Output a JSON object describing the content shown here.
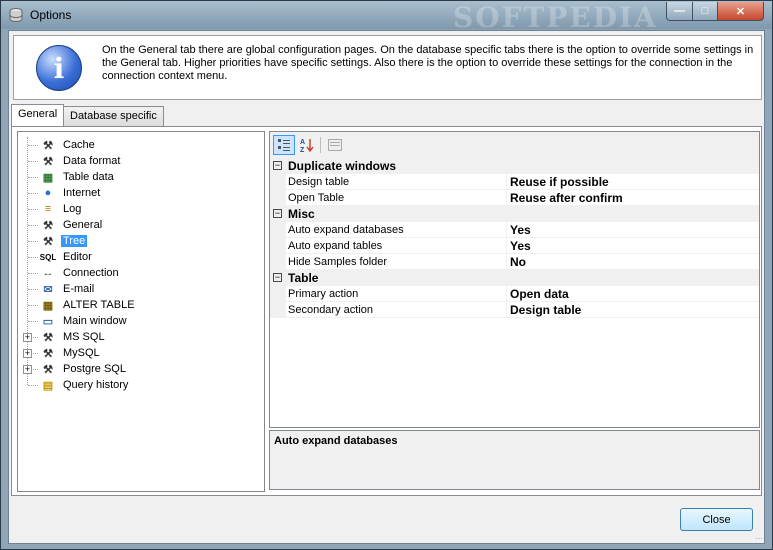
{
  "window": {
    "title": "Options",
    "watermark": "SOFTPEDIA"
  },
  "info": {
    "text": "On the General tab there are global configuration pages. On the database specific tabs there is the option to override some settings in the General tab. Higher priorities have specific settings. Also there is the option to override these settings for the connection in the connection context menu.",
    "icon": "info-icon"
  },
  "tabs": [
    {
      "label": "General",
      "active": true
    },
    {
      "label": "Database specific",
      "active": false
    }
  ],
  "tree": {
    "items": [
      {
        "label": "Cache",
        "icon": "tools-icon"
      },
      {
        "label": "Data format",
        "icon": "tools-icon"
      },
      {
        "label": "Table data",
        "icon": "table-icon"
      },
      {
        "label": "Internet",
        "icon": "globe-icon"
      },
      {
        "label": "Log",
        "icon": "log-icon"
      },
      {
        "label": "General",
        "icon": "tools-icon"
      },
      {
        "label": "Tree",
        "icon": "tools-icon",
        "selected": true
      },
      {
        "label": "Editor",
        "icon": "sql-icon"
      },
      {
        "label": "Connection",
        "icon": "connection-icon"
      },
      {
        "label": "E-mail",
        "icon": "mail-icon"
      },
      {
        "label": "ALTER TABLE",
        "icon": "alter-table-icon"
      },
      {
        "label": "Main window",
        "icon": "window-icon"
      },
      {
        "label": "MS SQL",
        "icon": "tools-icon",
        "expandable": true
      },
      {
        "label": "MySQL",
        "icon": "tools-icon",
        "expandable": true
      },
      {
        "label": "Postgre SQL",
        "icon": "tools-icon",
        "expandable": true
      },
      {
        "label": "Query history",
        "icon": "history-icon"
      }
    ]
  },
  "propgrid": {
    "categories": [
      {
        "label": "Duplicate windows",
        "props": [
          {
            "name": "Design table",
            "value": "Reuse if possible"
          },
          {
            "name": "Open Table",
            "value": "Reuse after confirm"
          }
        ]
      },
      {
        "label": "Misc",
        "props": [
          {
            "name": "Auto expand databases",
            "value": "Yes"
          },
          {
            "name": "Auto expand tables",
            "value": "Yes"
          },
          {
            "name": "Hide Samples folder",
            "value": "No"
          }
        ]
      },
      {
        "label": "Table",
        "props": [
          {
            "name": "Primary action",
            "value": "Open data"
          },
          {
            "name": "Secondary action",
            "value": "Design table"
          }
        ]
      }
    ],
    "description_title": "Auto expand databases"
  },
  "buttons": {
    "close": "Close"
  },
  "colors": {
    "selection": "#3399ff",
    "titlebar": "#8ea6b8",
    "close_caption": "#c6472c"
  }
}
